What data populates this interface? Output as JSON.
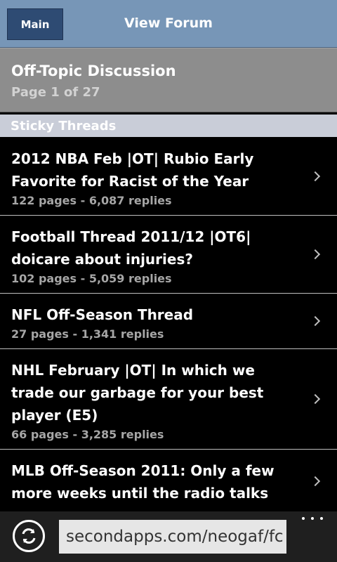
{
  "header": {
    "main_button": "Main",
    "title": "View Forum"
  },
  "forum": {
    "name": "Off-Topic Discussion",
    "page_info": "Page 1 of 27"
  },
  "section": {
    "label": "Sticky Threads"
  },
  "threads": [
    {
      "title": "2012 NBA Feb |OT| Rubio Early Favorite for Racist of the Year",
      "meta": "122 pages - 6,087 replies"
    },
    {
      "title": "Football Thread 2011/12 |OT6| doicare about injuries?",
      "meta": "102 pages - 5,059 replies"
    },
    {
      "title": "NFL Off-Season Thread",
      "meta": "27 pages - 1,341 replies"
    },
    {
      "title": "NHL February |OT| In which we trade our garbage for your best player (E5)",
      "meta": "66 pages - 3,285 replies"
    },
    {
      "title": "MLB Off-Season 2011: Only a few more weeks until the radio talks",
      "meta": ""
    }
  ],
  "appbar": {
    "url": "secondapps.com/neogaf/fc",
    "refresh_icon": "refresh-icon",
    "more_icon": "more-icon"
  }
}
